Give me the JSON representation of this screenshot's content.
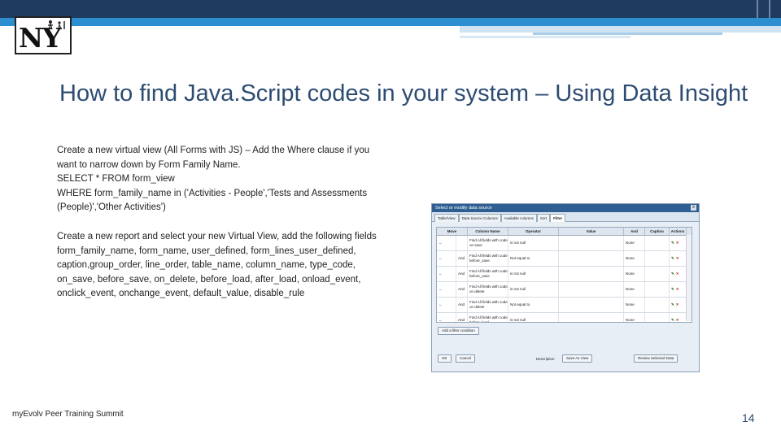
{
  "logo": {
    "text": "NY"
  },
  "title": "How to find Java.Script codes in your system – Using Data Insight",
  "paragraph1": [
    "Create a new virtual view (All Forms with JS) – Add the Where clause if you want to narrow down by Form Family Name.",
    "SELECT * FROM form_view",
    "WHERE form_family_name in ('Activities - People','Tests and Assessments (People)','Other Activities')"
  ],
  "paragraph2": [
    "Create a new report and select your new Virtual View, add the following fields",
    "form_family_name, form_name, user_defined, form_lines_user_defined, caption,group_order, line_order, table_name, column_name, type_code, on_save, before_save, on_delete, before_load, after_load, onload_event, onclick_event, onchange_event, default_value, disable_rule"
  ],
  "footer": "myEvolv Peer Training Summit",
  "page_number": "14",
  "dialog": {
    "title": "Select or modify data source",
    "close": "x",
    "tabs": [
      "Table/View",
      "Data Source Columns",
      "Available columns",
      "Sort",
      "Filter"
    ],
    "active_tab": 4,
    "columns": [
      "Move",
      "Column Name",
      "Operator",
      "Value",
      "And",
      "Caption",
      "Actions"
    ],
    "rows": [
      {
        "move": "↔",
        "andor": "",
        "column": "Find All fields with code on save",
        "operator": "is not null",
        "value": "",
        "logic": "None"
      },
      {
        "move": "↔",
        "andor": "And",
        "column": "Find All fields with code before_save",
        "operator": "Not equal to",
        "value": "",
        "logic": "None"
      },
      {
        "move": "↔",
        "andor": "And",
        "column": "Find All fields with code before_save",
        "operator": "is not null",
        "value": "",
        "logic": "None"
      },
      {
        "move": "↔",
        "andor": "And",
        "column": "Find All fields with code on delete",
        "operator": "is not null",
        "value": "",
        "logic": "None"
      },
      {
        "move": "↔",
        "andor": "And",
        "column": "Find All fields with code on delete",
        "operator": "Not equal to",
        "value": "",
        "logic": "None"
      },
      {
        "move": "↔",
        "andor": "And",
        "column": "Find All fields with code before_load",
        "operator": "is not null",
        "value": "",
        "logic": "None"
      }
    ],
    "buttons": {
      "add_filter": "Add a filter condition",
      "ok": "OK",
      "cancel": "Cancel",
      "save_as": "Save As View",
      "review": "Review Selected Data",
      "description_label": "Description"
    },
    "colors": {
      "titlebar": "#2f5f92",
      "edit": "#3a7a3a",
      "delete": "#c0251b"
    }
  },
  "colors": {
    "topbar": "#1f3b60",
    "accent": "#2d8fd0",
    "title": "#2d4c72"
  }
}
